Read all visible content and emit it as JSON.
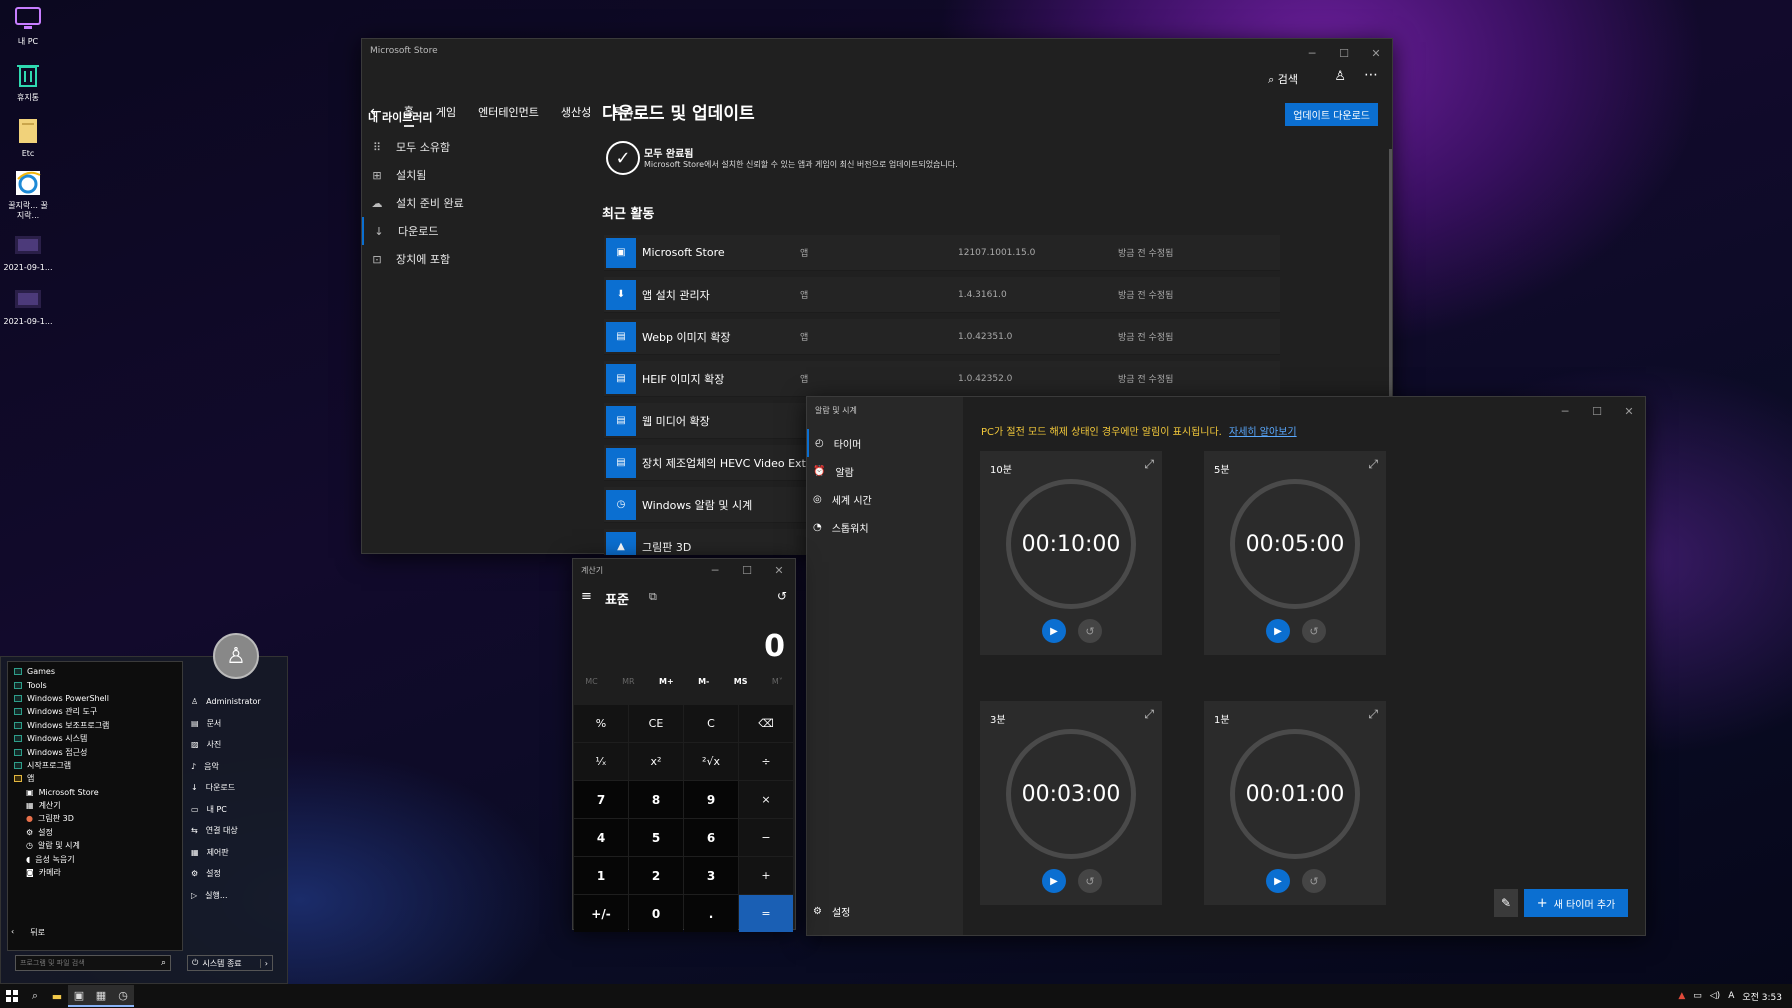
{
  "desktop": {
    "icons": [
      {
        "label": "내 PC",
        "name": "my-pc-icon"
      },
      {
        "label": "휴지통",
        "name": "recycle-bin-icon"
      },
      {
        "label": "Etc",
        "name": "folder-icon"
      },
      {
        "label": "꿀지락... 꿀지락...",
        "name": "internet-explorer-icon"
      },
      {
        "label": "2021-09-1...",
        "name": "screenshot-file-icon"
      },
      {
        "label": "2021-09-1...",
        "name": "screenshot-file-icon"
      }
    ]
  },
  "store": {
    "title": "Microsoft Store",
    "tabs": [
      "홈",
      "게임",
      "엔터테인먼트",
      "생산성",
      "특가"
    ],
    "search_label": "검색",
    "library_title": "내 라이브러리",
    "library_items": [
      {
        "label": "모두 소유함",
        "icon": "grid-icon"
      },
      {
        "label": "설치됨",
        "icon": "installed-icon"
      },
      {
        "label": "설치 준비 완료",
        "icon": "cloud-icon"
      },
      {
        "label": "다운로드",
        "icon": "download-icon"
      },
      {
        "label": "장치에 포함",
        "icon": "device-icon"
      }
    ],
    "page_title": "다운로드 및 업데이트",
    "update_button": "업데이트 다운로드",
    "status_title": "모두 완료됨",
    "status_desc": "Microsoft Store에서 설치한 신뢰할 수 있는 앱과 게임이 최신 버전으로 업데이트되었습니다.",
    "recent_title": "최근 활동",
    "activity": [
      {
        "name": "Microsoft Store",
        "type": "앱",
        "version": "12107.1001.15.0",
        "modified": "방금 전 수정됨"
      },
      {
        "name": "앱 설치 관리자",
        "type": "앱",
        "version": "1.4.3161.0",
        "modified": "방금 전 수정됨"
      },
      {
        "name": "Webp 이미지 확장",
        "type": "앱",
        "version": "1.0.42351.0",
        "modified": "방금 전 수정됨"
      },
      {
        "name": "HEIF 이미지 확장",
        "type": "앱",
        "version": "1.0.42352.0",
        "modified": "방금 전 수정됨"
      },
      {
        "name": "웹 미디어 확장",
        "type": "",
        "version": "",
        "modified": ""
      },
      {
        "name": "장치 제조업체의 HEVC Video Exte",
        "type": "",
        "version": "",
        "modified": ""
      },
      {
        "name": "Windows 알람 및 시계",
        "type": "",
        "version": "",
        "modified": ""
      },
      {
        "name": "그림판 3D",
        "type": "",
        "version": "",
        "modified": ""
      }
    ]
  },
  "calculator": {
    "title": "계산기",
    "mode": "표준",
    "display": "0",
    "memory": [
      "MC",
      "MR",
      "M+",
      "M-",
      "MS",
      "M˅"
    ],
    "keys": [
      "%",
      "CE",
      "C",
      "⌫",
      "¹⁄ₓ",
      "x²",
      "²√x",
      "÷",
      "7",
      "8",
      "9",
      "×",
      "4",
      "5",
      "6",
      "−",
      "1",
      "2",
      "3",
      "+",
      "+/-",
      "0",
      ".",
      "="
    ]
  },
  "clock": {
    "title": "알람 및 시계",
    "nav": [
      {
        "label": "타이머",
        "icon": "timer-icon"
      },
      {
        "label": "알람",
        "icon": "alarm-icon"
      },
      {
        "label": "세계 시간",
        "icon": "world-clock-icon"
      },
      {
        "label": "스톱워치",
        "icon": "stopwatch-icon"
      }
    ],
    "settings_label": "설정",
    "notice": "PC가 절전 모드 해제 상태인 경우에만 알림이 표시됩니다.",
    "notice_link": "자세히 알아보기",
    "timers": [
      {
        "label": "10분",
        "time": "00:10:00"
      },
      {
        "label": "5분",
        "time": "00:05:00"
      },
      {
        "label": "3분",
        "time": "00:03:00"
      },
      {
        "label": "1분",
        "time": "00:01:00"
      }
    ],
    "add_timer": "새 타이머 추가"
  },
  "start_menu": {
    "left_items": [
      {
        "label": "Games",
        "kind": "folder"
      },
      {
        "label": "Tools",
        "kind": "folder"
      },
      {
        "label": "Windows PowerShell",
        "kind": "folder"
      },
      {
        "label": "Windows 관리 도구",
        "kind": "folder"
      },
      {
        "label": "Windows 보조프로그램",
        "kind": "folder"
      },
      {
        "label": "Windows 시스템",
        "kind": "folder"
      },
      {
        "label": "Windows 접근성",
        "kind": "folder"
      },
      {
        "label": "시작프로그램",
        "kind": "folder"
      },
      {
        "label": "앱",
        "kind": "folder-open"
      },
      {
        "label": "Microsoft Store",
        "kind": "app"
      },
      {
        "label": "계산기",
        "kind": "app"
      },
      {
        "label": "그림판 3D",
        "kind": "app"
      },
      {
        "label": "설정",
        "kind": "app"
      },
      {
        "label": "알람 및 시계",
        "kind": "app"
      },
      {
        "label": "음성 녹음기",
        "kind": "app"
      },
      {
        "label": "카메라",
        "kind": "app"
      }
    ],
    "back_label": "뒤로",
    "search_placeholder": "프로그램 및 파일 검색",
    "user_name": "Administrator",
    "right_items": [
      {
        "label": "문서",
        "icon": "document-icon"
      },
      {
        "label": "사진",
        "icon": "picture-icon"
      },
      {
        "label": "음악",
        "icon": "music-icon"
      },
      {
        "label": "다운로드",
        "icon": "download-icon"
      },
      {
        "label": "내 PC",
        "icon": "computer-icon"
      },
      {
        "label": "연결 대상",
        "icon": "connect-icon"
      },
      {
        "label": "제어판",
        "icon": "control-panel-icon"
      },
      {
        "label": "설정",
        "icon": "settings-icon"
      },
      {
        "label": "실행...",
        "icon": "run-icon"
      }
    ],
    "shutdown_label": "시스템 종료"
  },
  "taskbar": {
    "clock": "오전 3:53",
    "ime": "A"
  }
}
